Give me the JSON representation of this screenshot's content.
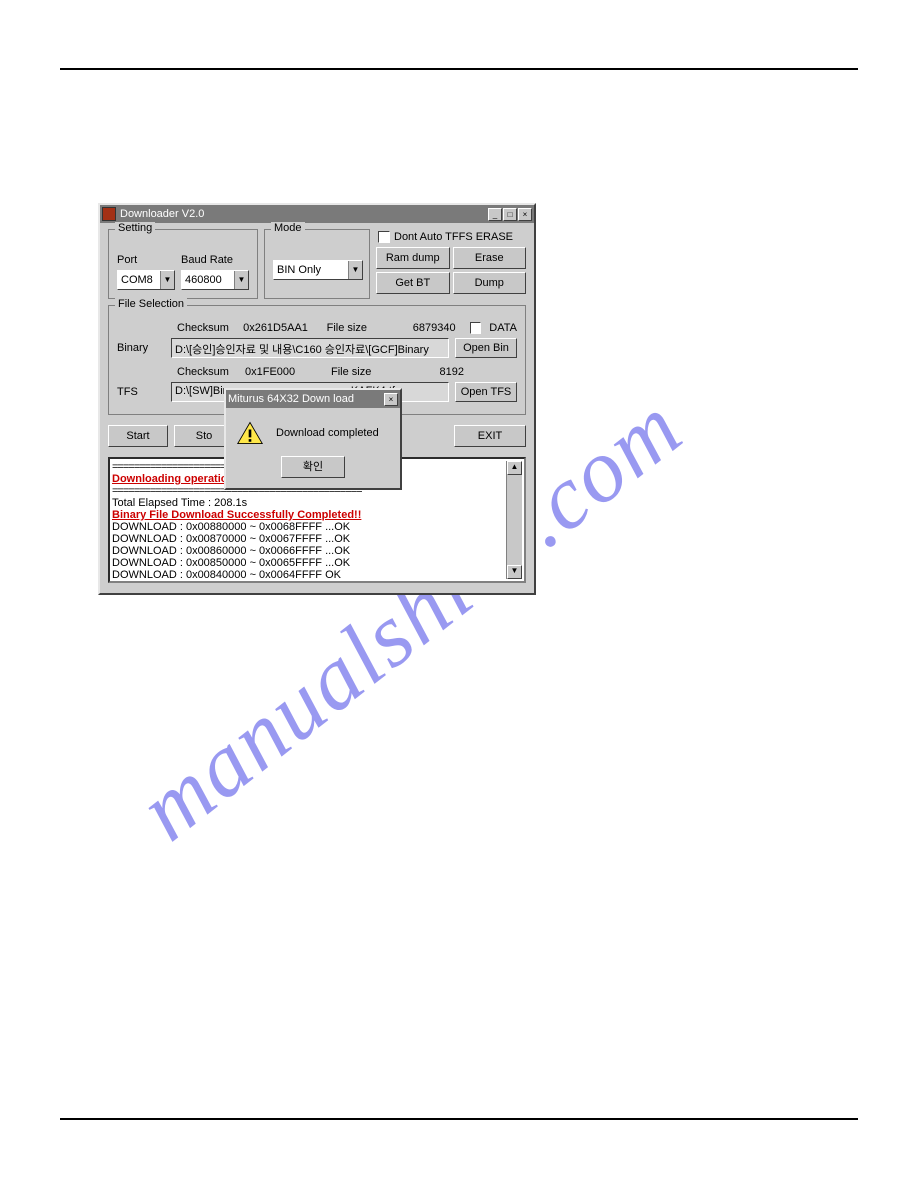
{
  "watermark": "manualshive.com",
  "window": {
    "title": "Downloader V2.0"
  },
  "setting": {
    "legend": "Setting",
    "port_label": "Port",
    "baud_label": "Baud Rate",
    "port_value": "COM8",
    "baud_value": "460800"
  },
  "mode": {
    "legend": "Mode",
    "value": "BIN Only"
  },
  "tffs": {
    "checkbox_label": "Dont Auto TFFS ERASE",
    "ram_dump": "Ram dump",
    "erase": "Erase",
    "get_bt": "Get BT",
    "dump": "Dump"
  },
  "file_selection": {
    "legend": "File Selection",
    "bin_checksum_label": "Checksum",
    "bin_checksum_value": "0x261D5AA1",
    "bin_filesize_label": "File size",
    "bin_filesize_value": "6879340",
    "data_checkbox": "DATA",
    "binary_label": "Binary",
    "binary_path": "D:\\[승인]승인자료 및 내용\\C160 승인자료\\[GCF]Binary",
    "open_bin": "Open Bin",
    "tfs_checksum_label": "Checksum",
    "tfs_checksum_value": "0x1FE000",
    "tfs_filesize_label": "File size",
    "tfs_filesize_value": "8192",
    "tfs_label": "TFS",
    "tfs_path_prefix": "D:\\[SW]Bin",
    "tfs_path_suffix": "KAFK4.tfs",
    "open_tfs": "Open TFS"
  },
  "actions": {
    "start": "Start",
    "stop": "Sto",
    "exit": "EXIT"
  },
  "popup": {
    "title": "Miturus 64X32 Down load",
    "message": "Download completed",
    "ok": "확인"
  },
  "log": {
    "rule": "==============================================",
    "line1": "Downloading operation successfully finished.",
    "elapsed": "Total Elapsed Time : 208.1s",
    "bin_done": "Binary File Download Successfully Completed!!",
    "dl1": "DOWNLOAD : 0x00880000 ~ 0x0068FFFF ...OK",
    "dl2": "DOWNLOAD : 0x00870000 ~ 0x0067FFFF ...OK",
    "dl3": "DOWNLOAD : 0x00860000 ~ 0x0066FFFF ...OK",
    "dl4": "DOWNLOAD : 0x00850000 ~ 0x0065FFFF ...OK",
    "dl5": "DOWNLOAD : 0x00840000 ~ 0x0064FFFF    OK"
  }
}
